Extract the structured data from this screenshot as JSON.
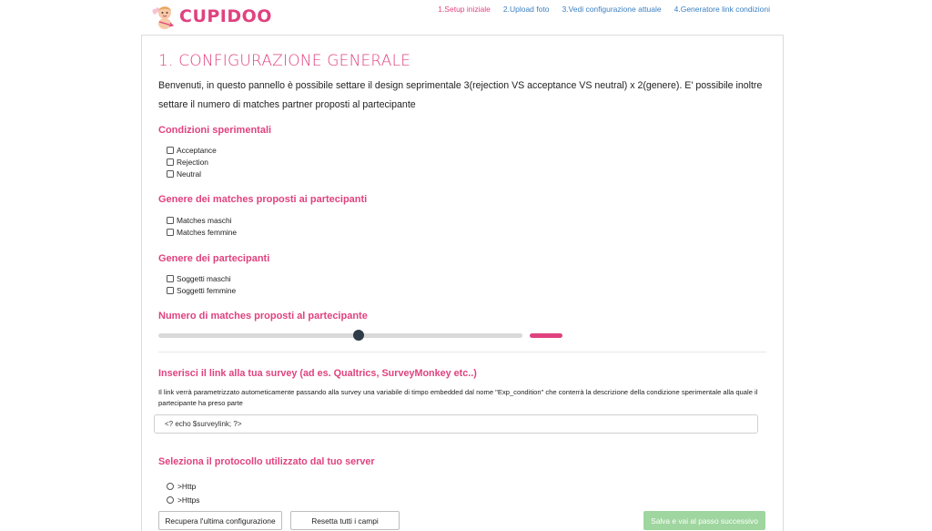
{
  "brand": {
    "name": "CUPIDOO"
  },
  "nav": [
    {
      "label": "1.Setup iniziale",
      "active": true
    },
    {
      "label": "2.Upload foto",
      "active": false
    },
    {
      "label": "3.Vedi configurazione attuale",
      "active": false
    },
    {
      "label": "4.Generatore link condizioni",
      "active": false
    }
  ],
  "page": {
    "title": "1. CONFIGURAZIONE GENERALE",
    "intro": "Benvenuti, in questo pannello è possibile settare il design seprimentale 3(rejection VS acceptance VS neutral) x 2(genere). E' possibile inoltre settare il numero di matches partner proposti al partecipante"
  },
  "conditions": {
    "heading": "Condizioni sperimentali",
    "options": [
      "Acceptance",
      "Rejection",
      "Neutral"
    ]
  },
  "match_gender": {
    "heading": "Genere dei matches proposti ai partecipanti",
    "options": [
      "Matches maschi",
      "Matches femmine"
    ]
  },
  "participant_gender": {
    "heading": "Genere dei partecipanti",
    "options": [
      "Soggetti maschi",
      "Soggetti femmine"
    ]
  },
  "matches_count": {
    "heading": "Numero di matches proposti al partecipante",
    "slider_fraction": 0.55
  },
  "survey": {
    "heading": "Inserisci il link alla tua survey (ad es. Qualtrics, SurveyMonkey etc..)",
    "help": "Il link verrà parametrizzato autometicamente passando alla survey una variabile di timpo embedded dal nome \"Exp_condition\" che conterrà la descrizione della condizione sperimentale alla quale il partecipante ha preso parte",
    "value": "<? echo $surveylink; ?>"
  },
  "protocol": {
    "heading": "Seleziona il protocollo utilizzato dal tuo server",
    "options": [
      ">Http",
      ">Https"
    ]
  },
  "buttons": {
    "recover": "Recupera l'ultima configurazione",
    "reset": "Resetta tutti i campi",
    "save": "Salva e vai al passo successivo"
  },
  "colors": {
    "accent": "#e0427f",
    "link": "#3a7fc1",
    "primary_button": "#9fd69f"
  }
}
